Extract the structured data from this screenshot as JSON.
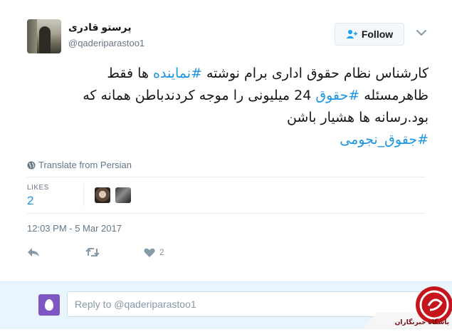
{
  "account": {
    "name": "پرستو قادری",
    "handle": "@qaderiparastoo1"
  },
  "follow_button": {
    "label": "Follow"
  },
  "tweet": {
    "line1_pre": "کارشناس نظام حقوق اداری برام نوشته ",
    "line1_hash": "#نماینده",
    "line1_post": " ها فقط",
    "line2_pre": "ظاهرمسئله ",
    "line2_hash": "#حقوق",
    "line2_post": " 24 میلیونی را موجه کردندباطن همانه که",
    "line3": "بود.رسانه ها هشیار باشن",
    "line4_hash": "#جقوق_نجومی"
  },
  "translate_label": "Translate from Persian",
  "likes": {
    "label": "LIKES",
    "count": "2"
  },
  "timestamp": "12:03 PM - 5 Mar 2017",
  "actions": {
    "like_count": "2"
  },
  "reply": {
    "placeholder": "Reply to @qaderiparastoo1"
  },
  "watermark": {
    "text": "باشگاه خبرنگاران"
  },
  "colors": {
    "link": "#1b95e0",
    "muted": "#657786",
    "reply_bg": "#e8f5fd",
    "watermark": "#c4161c"
  }
}
